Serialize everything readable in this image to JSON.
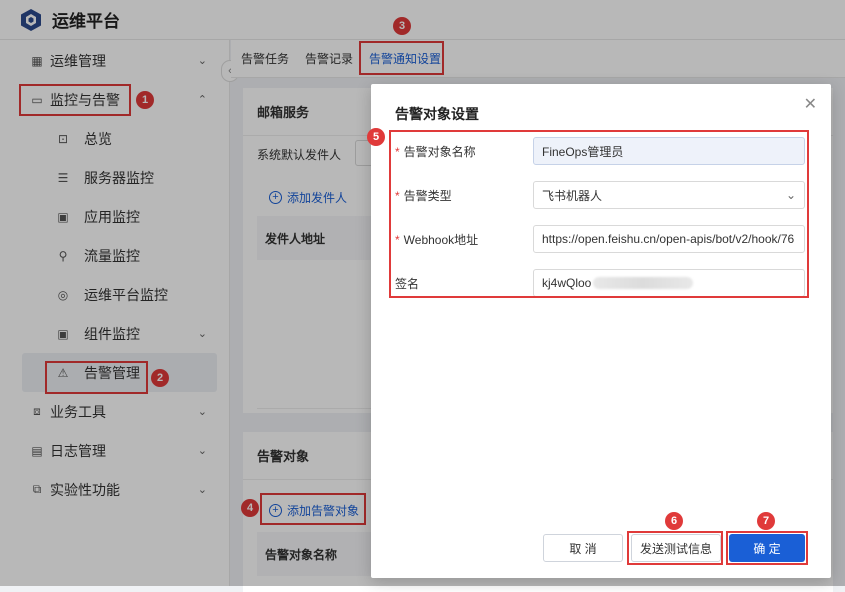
{
  "app": {
    "title": "运维平台"
  },
  "sidebar": {
    "items": [
      {
        "label": "运维管理",
        "icon": "grid-icon",
        "chevron": "⌄"
      },
      {
        "label": "监控与告警",
        "icon": "monitor-icon",
        "chevron": "⌃"
      },
      {
        "label": "总览",
        "icon": "overview-icon"
      },
      {
        "label": "服务器监控",
        "icon": "server-icon"
      },
      {
        "label": "应用监控",
        "icon": "app-icon"
      },
      {
        "label": "流量监控",
        "icon": "traffic-icon"
      },
      {
        "label": "运维平台监控",
        "icon": "platform-icon"
      },
      {
        "label": "组件监控",
        "icon": "component-icon",
        "chevron": "⌄"
      },
      {
        "label": "告警管理",
        "icon": "warning-icon"
      },
      {
        "label": "业务工具",
        "icon": "code-icon",
        "chevron": "⌄"
      },
      {
        "label": "日志管理",
        "icon": "calendar-icon",
        "chevron": "⌄"
      },
      {
        "label": "实验性功能",
        "icon": "lab-icon",
        "chevron": "⌄"
      }
    ]
  },
  "tabs": [
    {
      "label": "告警任务"
    },
    {
      "label": "告警记录"
    },
    {
      "label": "告警通知设置"
    }
  ],
  "mail_card": {
    "title": "邮箱服务",
    "default_sender_label": "系统默认发件人",
    "add_sender": "添加发件人",
    "sender_address_header": "发件人地址"
  },
  "target_card": {
    "title": "告警对象",
    "add_target": "添加告警对象",
    "target_name_header": "告警对象名称"
  },
  "modal": {
    "title": "告警对象设置",
    "fields": {
      "name": {
        "label": "告警对象名称",
        "value": "FineOps管理员",
        "required": true
      },
      "type": {
        "label": "告警类型",
        "value": "飞书机器人",
        "required": true
      },
      "webhook": {
        "label": "Webhook地址",
        "value": "https://open.feishu.cn/open-apis/bot/v2/hook/76",
        "required": true
      },
      "sign": {
        "label": "签名",
        "value": "kj4wQloo",
        "required": false
      }
    },
    "buttons": {
      "cancel": "取 消",
      "test": "发送测试信息",
      "confirm": "确 定"
    }
  },
  "annotations": [
    "1",
    "2",
    "3",
    "4",
    "5",
    "6",
    "7"
  ],
  "colors": {
    "primary": "#1a5fd6",
    "annotation": "#e03a3a"
  }
}
